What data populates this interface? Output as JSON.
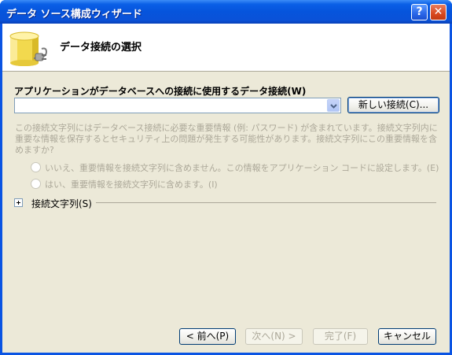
{
  "window": {
    "title": "データ ソース構成ウィザード",
    "help_symbol": "?",
    "close_symbol": "✕"
  },
  "header": {
    "title": "データ接続の選択",
    "icon": "database-plug-icon"
  },
  "connection": {
    "label": "アプリケーションがデータベースへの接続に使用するデータ接続(W)",
    "combo_value": "",
    "new_connection_button": "新しい接続(C)..."
  },
  "security": {
    "description": "この接続文字列にはデータベース接続に必要な重要情報 (例: パスワード) が含まれています。接続文字列内に重要な情報を保存するとセキュリティ上の問題が発生する可能性があります。接続文字列にこの重要情報を含めますか?",
    "option_exclude": "いいえ、重要情報を接続文字列に含めません。この情報をアプリケーション コードに設定します。(E)",
    "option_include": "はい、重要情報を接続文字列に含めます。(I)"
  },
  "expander": {
    "label": "接続文字列(S)"
  },
  "footer": {
    "back": "< 前へ(P)",
    "next": "次へ(N) >",
    "finish": "完了(F)",
    "cancel": "キャンセル"
  },
  "colors": {
    "titlebar": "#0a54e3",
    "dialog_bg": "#ece9d8",
    "disabled_text": "#aca899"
  }
}
